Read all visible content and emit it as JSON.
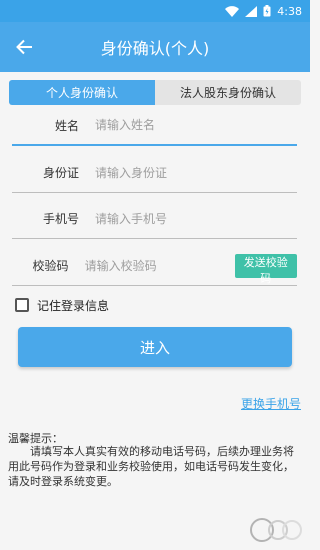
{
  "status_bar": {
    "time": "4:38"
  },
  "app_bar": {
    "title": "身份确认(个人)"
  },
  "tabs": [
    {
      "label": "个人身份确认",
      "active": true
    },
    {
      "label": "法人股东身份确认",
      "active": false
    }
  ],
  "form": {
    "name": {
      "label": "姓名",
      "placeholder": "请输入姓名"
    },
    "id_card": {
      "label": "身份证",
      "placeholder": "请输入身份证"
    },
    "phone": {
      "label": "手机号",
      "placeholder": "请输入手机号"
    },
    "code": {
      "label": "校验码",
      "placeholder": "请输入校验码",
      "send_button": "发送校验码"
    }
  },
  "remember": {
    "label": "记住登录信息",
    "checked": false
  },
  "enter_button": "进入",
  "change_phone_link": "更换手机号",
  "notice": {
    "title": "温馨提示：",
    "body": "请填写本人真实有效的移动电话号码，后续办理业务将用此号码作为登录和业务校验使用，如电话号码发生变化，请及时登录系统变更。"
  },
  "colors": {
    "primary": "#4aa8ea",
    "accent_green": "#3fc1a8",
    "link": "#3aa3e8"
  }
}
